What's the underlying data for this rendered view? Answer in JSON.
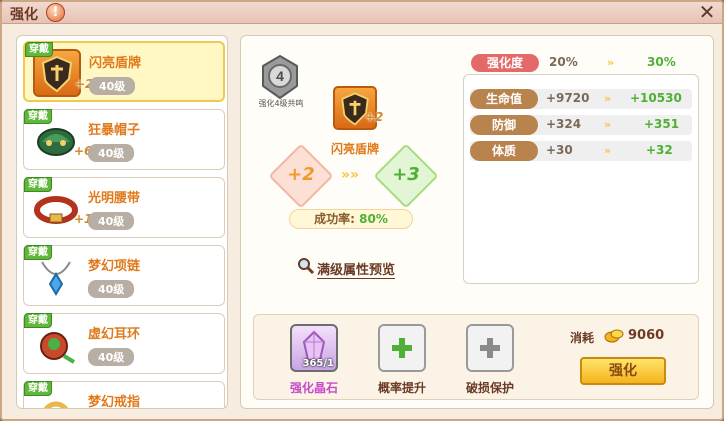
{
  "window": {
    "title": "强化"
  },
  "items": [
    {
      "badge": "穿戴",
      "name": "闪亮盾牌",
      "level": "40级",
      "plus": "+2",
      "icon": "shield-icon",
      "selected": true
    },
    {
      "badge": "穿戴",
      "name": "狂暴帽子",
      "level": "40级",
      "plus": "+6",
      "icon": "helmet-icon",
      "selected": false
    },
    {
      "badge": "穿戴",
      "name": "光明腰带",
      "level": "40级",
      "plus": "+1",
      "icon": "belt-icon",
      "selected": false
    },
    {
      "badge": "穿戴",
      "name": "梦幻项链",
      "level": "40级",
      "plus": "",
      "icon": "necklace-icon",
      "selected": false
    },
    {
      "badge": "穿戴",
      "name": "虚幻耳环",
      "level": "40级",
      "plus": "",
      "icon": "earring-icon",
      "selected": false
    },
    {
      "badge": "穿戴",
      "name": "梦幻戒指",
      "level": "",
      "plus": "",
      "icon": "ring-icon",
      "selected": false
    }
  ],
  "detail": {
    "rank_number": "4",
    "rank_label": "强化4级共鸣",
    "item_name": "闪亮盾牌",
    "item_plus": "+2",
    "from_level": "+2",
    "to_level": "+3",
    "success_label": "成功率:",
    "success_value": "80%",
    "preview_label": "满级属性预览"
  },
  "strength": {
    "label": "强化度",
    "from": "20%",
    "to": "30%"
  },
  "stats": [
    {
      "label": "生命值",
      "from": "+9720",
      "to": "+10530"
    },
    {
      "label": "防御",
      "from": "+324",
      "to": "+351"
    },
    {
      "label": "体质",
      "from": "+30",
      "to": "+32"
    }
  ],
  "bottom": {
    "crystal_label": "强化晶石",
    "crystal_count": "365/1",
    "rate_up_label": "概率提升",
    "protect_label": "破损保护",
    "cost_label": "消耗",
    "cost_value": "9060",
    "strengthen_button": "强化"
  },
  "colors": {
    "accent": "#e07a1c",
    "green": "#4fb036",
    "badge_green": "#5fb839",
    "strength_red": "#e46a6a"
  }
}
